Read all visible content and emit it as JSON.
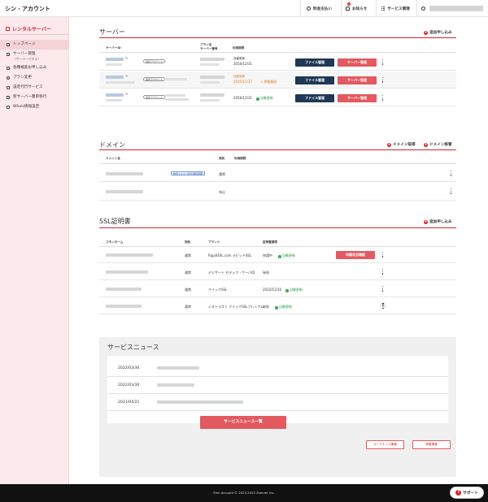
{
  "header": {
    "logo_prefix": "シン",
    "logo_dot": "・",
    "logo_suffix": "アカウント",
    "nav": [
      {
        "label": "料金支払い",
        "icon": "yen-icon"
      },
      {
        "label": "お知らせ",
        "icon": "bell-icon",
        "badge": "1"
      },
      {
        "label": "サービス管理",
        "icon": "grid-icon"
      }
    ]
  },
  "sidebar": {
    "brand": "レンタルサーバー",
    "items": [
      {
        "label": "トップページ",
        "icon": "home-icon",
        "active": true
      },
      {
        "label": "サーバー管理",
        "sub": "（サーバーパネル）",
        "icon": "server-icon"
      },
      {
        "label": "各種検索お申し込み",
        "icon": "list-icon"
      },
      {
        "label": "プラン変更",
        "icon": "refresh-icon"
      },
      {
        "label": "設定代行サービス",
        "icon": "wrench-icon"
      },
      {
        "label": "新サーバー簡単移行",
        "icon": "move-icon"
      },
      {
        "label": "Whois情報設定",
        "icon": "document-icon"
      }
    ]
  },
  "server": {
    "title": "サーバー",
    "add": "追加申し込み",
    "headers": [
      "サーバーID",
      "プラン名\nサーバー番号",
      "利用期限"
    ],
    "rows": [
      {
        "tag": "契約アカウント",
        "expiry_top": "自動更新",
        "expiry": "2050/12/31",
        "status": "",
        "file_btn": "ファイル管理",
        "panel_btn": "サーバー管理"
      },
      {
        "tag": "契約アカウント",
        "expiry_top": "自動更新",
        "expiry": "2025/11/17",
        "status": "期限間近",
        "file_btn": "ファイル管理",
        "panel_btn": "サーバー管理"
      },
      {
        "tag": "契約アカウント",
        "expiry_top": "",
        "expiry": "2050/12/31",
        "status": "自動更新",
        "file_btn": "ファイル管理",
        "panel_btn": "サーバー管理"
      }
    ]
  },
  "domain": {
    "title": "ドメイン",
    "buy": "ドメイン取得",
    "transfer": "ドメイン移管",
    "headers": [
      "ドメイン名",
      "契約",
      "利用期限"
    ],
    "rows": [
      {
        "tag": "独自ドメイン永久無料特典",
        "contract": "通常"
      },
      {
        "tag": "",
        "contract": "申込"
      }
    ]
  },
  "ssl": {
    "title": "SSL証明書",
    "add": "追加申し込み",
    "headers": [
      "コモンネーム",
      "契約",
      "ブランド",
      "証明書期限"
    ],
    "rows": [
      {
        "contract": "通常",
        "brand": "RapidSSL.com ラピッドSSL",
        "state": "申請中",
        "renew": "自動更新",
        "btn": "申請状況確認"
      },
      {
        "contract": "通常",
        "brand": "デジサート セキュア・サーバID",
        "state": "有効",
        "renew": "",
        "btn": ""
      },
      {
        "contract": "通常",
        "brand": "クイックSSL",
        "state": "2022/12/20",
        "renew": "自動更新",
        "btn": ""
      },
      {
        "contract": "通常",
        "brand": "ジオトラスト クイックSSLプレミアム",
        "state": "有効",
        "renew": "自動更新",
        "btn": ""
      }
    ]
  },
  "news": {
    "title": "サービスニュース",
    "items": [
      {
        "date": "2022/03/30"
      },
      {
        "date": "2022/03/30"
      },
      {
        "date": "2021/04/21"
      }
    ],
    "list_btn": "サービスニュース一覧",
    "maintenance": "メンテナンス情報",
    "failure": "障害情報"
  },
  "footer": {
    "copyright": "Shin Account © 2023-2023 Xserver Inc.",
    "support": "サポート"
  }
}
